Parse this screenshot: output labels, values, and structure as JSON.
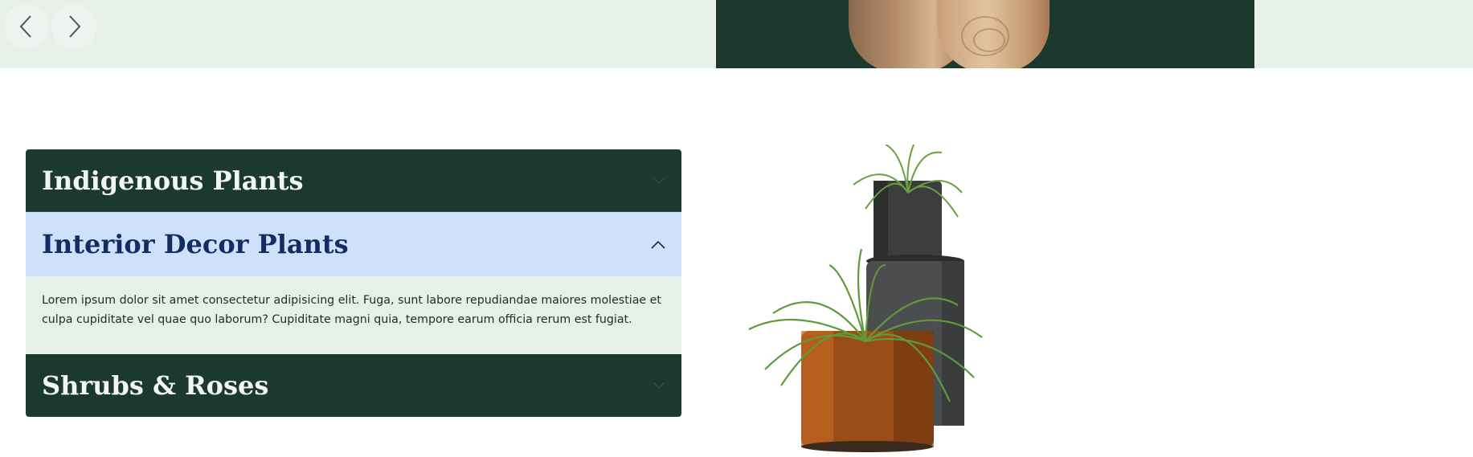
{
  "carousel": {
    "prev_icon": "chevron-left-icon",
    "next_icon": "chevron-right-icon"
  },
  "colors": {
    "top_band": "#e6f0e8",
    "hero_panel": "#1b3a2d",
    "accordion_dark": "#1b3a2d",
    "accordion_active": "#cfe0fb",
    "active_title": "#132d63",
    "body_bg": "#e6f0e8"
  },
  "accordion": {
    "items": [
      {
        "title": "Indigenous Plants",
        "expanded": false,
        "icon": "chevron-down-icon"
      },
      {
        "title": "Interior Decor Plants",
        "expanded": true,
        "icon": "chevron-up-icon",
        "body": "Lorem ipsum dolor sit amet consectetur adipisicing elit. Fuga, sunt labore repudiandae maiores molestiae et culpa cupiditate vel quae quo laborum? Cupiditate magni quia, tempore earum officia rerum est fugiat."
      },
      {
        "title": "Shrubs & Roses",
        "expanded": false,
        "icon": "chevron-down-icon"
      }
    ]
  },
  "image": {
    "subject": "potted-plants-image"
  }
}
